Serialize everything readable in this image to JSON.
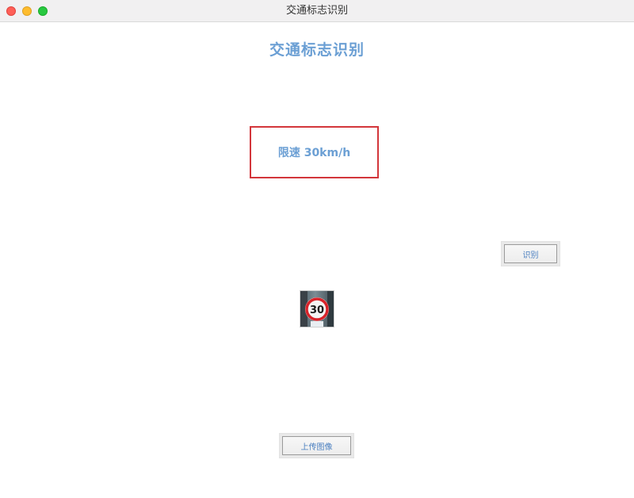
{
  "window": {
    "title": "交通标志识别"
  },
  "app": {
    "heading": "交通标志识别",
    "result_text": "限速 30km/h"
  },
  "buttons": {
    "recognize_label": "识别",
    "upload_label": "上传图像"
  },
  "image": {
    "sign_number": "30"
  },
  "colors": {
    "accent_text": "#6b9fd4",
    "result_border": "#d3363b",
    "sign_ring": "#d8232a"
  }
}
